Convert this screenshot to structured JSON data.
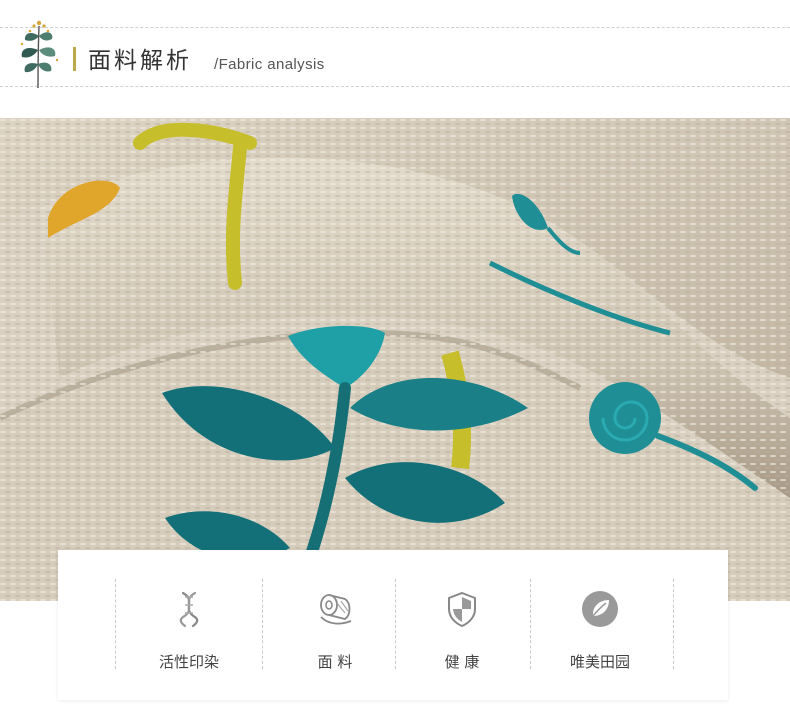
{
  "section": {
    "title_cn": "面料解析",
    "title_en": "/Fabric analysis",
    "accent": "#bda94a"
  },
  "photo": {
    "subject": "beige linen fabric with embroidered leaves",
    "colors": {
      "linen": "#d8cfc0",
      "teal": "#1f8e95",
      "yellow": "#c7be2c",
      "orange": "#e0a52b"
    }
  },
  "features": [
    {
      "label": "活性印染",
      "icon": "dna-icon"
    },
    {
      "label": "面 料",
      "icon": "fabric-roll-icon"
    },
    {
      "label": "健 康",
      "icon": "shield-icon"
    },
    {
      "label": "唯美田园",
      "icon": "leaf-circle-icon"
    }
  ]
}
